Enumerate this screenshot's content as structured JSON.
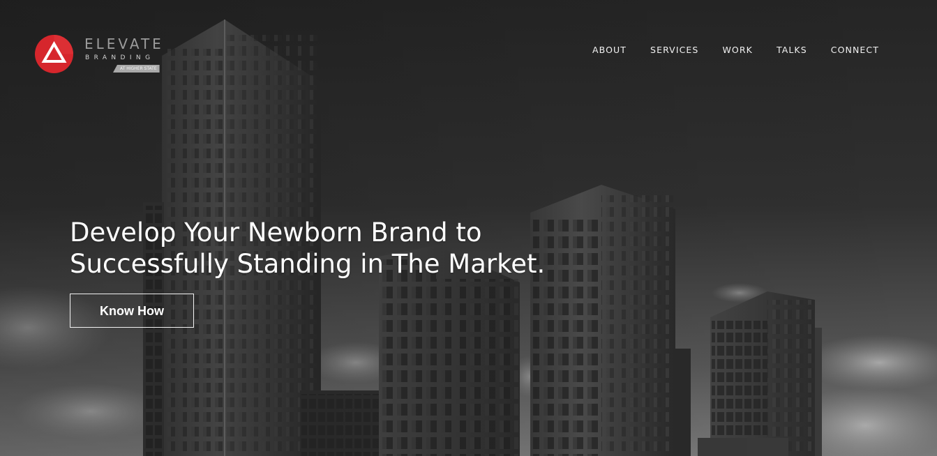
{
  "brand": {
    "name": "ELEVATE",
    "subtitle": "BRANDING",
    "tagline": "AT HIGHER STATE",
    "accent_color": "#d6262c",
    "logo_icon": "triangle-logo-icon"
  },
  "nav": {
    "items": [
      {
        "label": "ABOUT"
      },
      {
        "label": "SERVICES"
      },
      {
        "label": "WORK"
      },
      {
        "label": "TALKS"
      },
      {
        "label": "CONNECT"
      }
    ]
  },
  "hero": {
    "headline_line1": "Develop Your Newborn Brand to",
    "headline_line2": "Successfully Standing in The Market.",
    "cta_label": "Know How",
    "background": "grayscale-city-skyscrapers"
  }
}
